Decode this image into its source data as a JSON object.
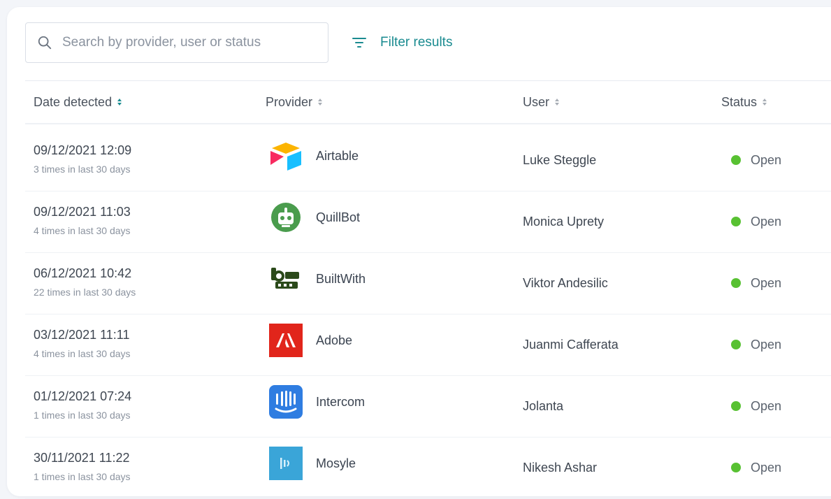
{
  "search": {
    "placeholder": "Search by provider, user or status",
    "value": ""
  },
  "filter": {
    "label": "Filter results"
  },
  "columns": {
    "date": "Date detected",
    "provider": "Provider",
    "user": "User",
    "status": "Status"
  },
  "rows": [
    {
      "date": "09/12/2021 12:09",
      "frequency": "3 times in last 30 days",
      "provider": "Airtable",
      "provider_icon": "airtable-logo-icon",
      "user": "Luke Steggle",
      "status": "Open"
    },
    {
      "date": "09/12/2021 11:03",
      "frequency": "4 times in last 30 days",
      "provider": "QuillBot",
      "provider_icon": "quillbot-logo-icon",
      "user": "Monica Uprety",
      "status": "Open"
    },
    {
      "date": "06/12/2021 10:42",
      "frequency": "22 times in last 30 days",
      "provider": "BuiltWith",
      "provider_icon": "builtwith-logo-icon",
      "user": "Viktor Andesilic",
      "status": "Open"
    },
    {
      "date": "03/12/2021 11:11",
      "frequency": "4 times in last 30 days",
      "provider": "Adobe",
      "provider_icon": "adobe-logo-icon",
      "user": "Juanmi Cafferata",
      "status": "Open"
    },
    {
      "date": "01/12/2021 07:24",
      "frequency": "1 times in last 30 days",
      "provider": "Intercom",
      "provider_icon": "intercom-logo-icon",
      "user": "Jolanta",
      "status": "Open"
    },
    {
      "date": "30/11/2021 11:22",
      "frequency": "1 times in last 30 days",
      "provider": "Mosyle",
      "provider_icon": "mosyle-logo-icon",
      "user": "Nikesh Ashar",
      "status": "Open"
    }
  ],
  "colors": {
    "accent": "#1a8b90",
    "status_open": "#58c132",
    "adobe": "#e1251b",
    "intercom": "#2f7de1",
    "mosyle": "#3aa5d8",
    "quillbot": "#4a9c4d"
  }
}
